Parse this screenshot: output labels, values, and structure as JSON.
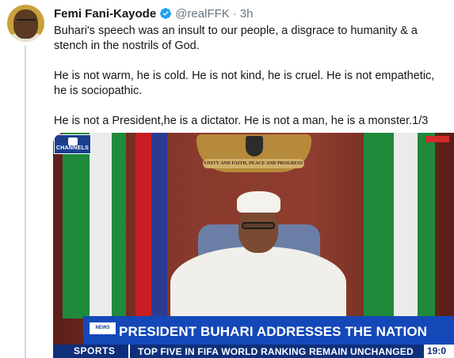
{
  "tweet": {
    "display_name": "Femi Fani-Kayode",
    "handle": "@realFFK",
    "separator": "·",
    "time": "3h",
    "paragraphs": [
      "Buhari's speech was an insult to our people, a disgrace to humanity & a stench in the nostrils of God.",
      "He is not warm, he is cold. He is not kind, he is cruel. He is not empathetic, he is sociopathic.",
      "He is not a President,he is a dictator. He is not a man, he is a monster.1/3"
    ],
    "icons": {
      "avatar": "avatar",
      "verified": "verified-badge-icon"
    },
    "colors": {
      "text": "#14171a",
      "secondary": "#657786",
      "verified": "#1da1f2",
      "thread_line": "#ccd6dd"
    }
  },
  "media": {
    "channel_logo": "CHANNELS",
    "coat_of_arms_motto": "UNITY AND FAITH, PEACE AND PROGRESS",
    "lower_third_tag": "NEWS",
    "headline": "PRESIDENT BUHARI ADDRESSES THE NATION",
    "ticker_label": "SPORTS",
    "ticker_text": "TOP FIVE IN FIFA WORLD RANKING REMAIN UNCHANGED",
    "ticker_time": "19:0",
    "colors": {
      "banner": "#1448b8",
      "ticker": "#0e2f7a",
      "flag_green": "#1f8a3b"
    }
  }
}
